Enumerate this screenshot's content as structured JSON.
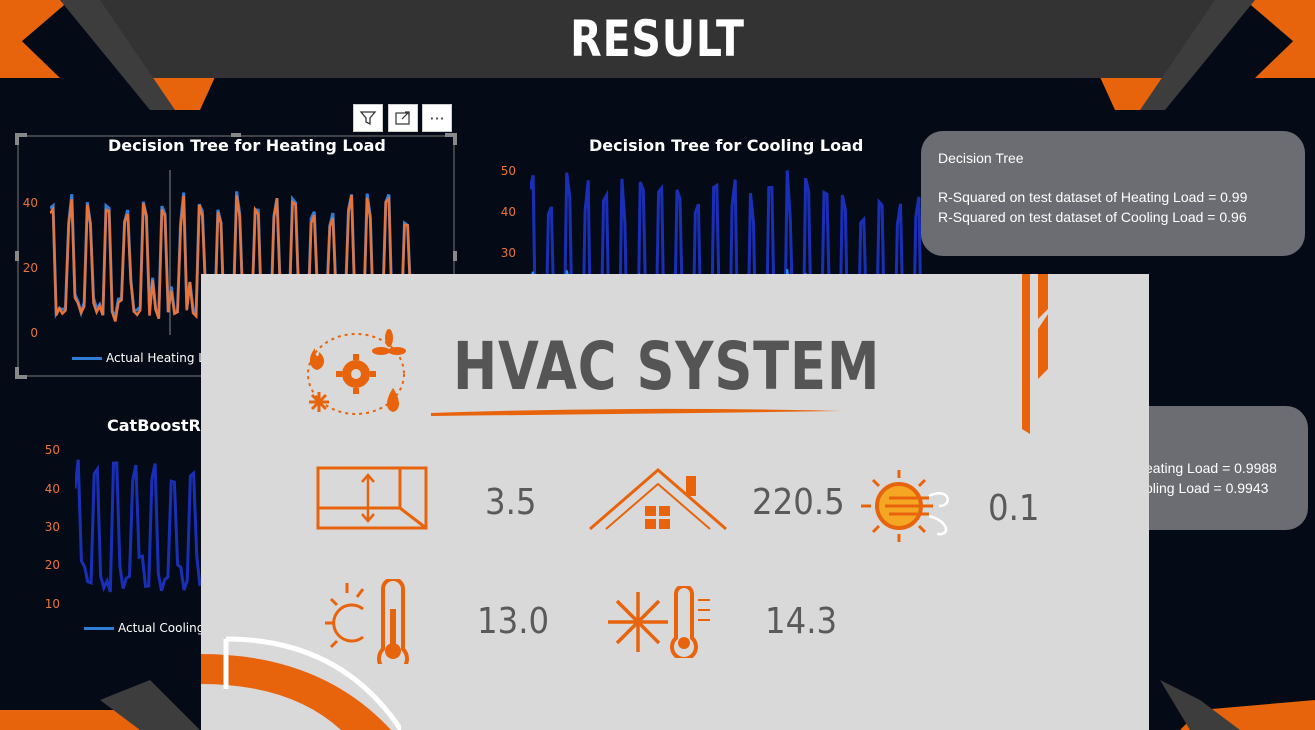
{
  "banner": {
    "title": "RESULT"
  },
  "colors": {
    "accent": "#e8640c",
    "dark_bg": "#050b16",
    "banner_bg": "#333333",
    "actual_line": "#2e7dd7",
    "pred_heating": "#e8743b",
    "cooling_line": "#1a2fb8",
    "cooling_pred": "#1e90ff",
    "card_bg": "#6b6d72",
    "panel_bg": "#d9d9d9",
    "metric_text": "#5a5a5a"
  },
  "toolbar": {
    "filter_icon": "filter-icon",
    "focus_icon": "focus-mode-icon",
    "more_icon": "more-options-icon",
    "more_label": "···"
  },
  "charts": {
    "heating": {
      "title": "Decision Tree for Heating Load",
      "ticks": [
        "40",
        "20",
        "0"
      ],
      "legend": "Actual Heating Lo"
    },
    "cooling": {
      "title": "Decision Tree for Cooling Load",
      "ticks": [
        "50",
        "40",
        "30"
      ]
    },
    "catboost": {
      "title": "CatBoostRe",
      "ticks": [
        "50",
        "40",
        "30",
        "20",
        "10"
      ],
      "legend": "Actual Cooling"
    }
  },
  "chart_data": [
    {
      "type": "line",
      "title": "Decision Tree for Heating Load",
      "ylim": [
        0,
        45
      ],
      "yticks": [
        0,
        20,
        40
      ],
      "series": [
        {
          "name": "Actual Heating Lo"
        }
      ]
    },
    {
      "type": "line",
      "title": "Decision Tree for Cooling Load",
      "yticks": [
        30,
        40,
        50
      ]
    },
    {
      "type": "line",
      "title": "CatBoostRe",
      "ylim": [
        10,
        50
      ],
      "yticks": [
        10,
        20,
        30,
        40,
        50
      ],
      "series": [
        {
          "name": "Actual Cooling"
        }
      ]
    }
  ],
  "cards": {
    "decision_tree": {
      "heading": "Decision Tree",
      "line1": "R-Squared on test dataset of Heating Load = 0.99",
      "line2": "R-Squared on test dataset of Cooling Load = 0.96"
    },
    "catboost": {
      "line1": "eating Load = 0.9988",
      "line2": "oling Load = 0.9943"
    }
  },
  "hvac": {
    "title": "HVAC SYSTEM",
    "metrics": {
      "window": "3.5",
      "house": "220.5",
      "sun_wind": "0.1",
      "sun_temp": "13.0",
      "snow_temp": "14.3"
    }
  }
}
